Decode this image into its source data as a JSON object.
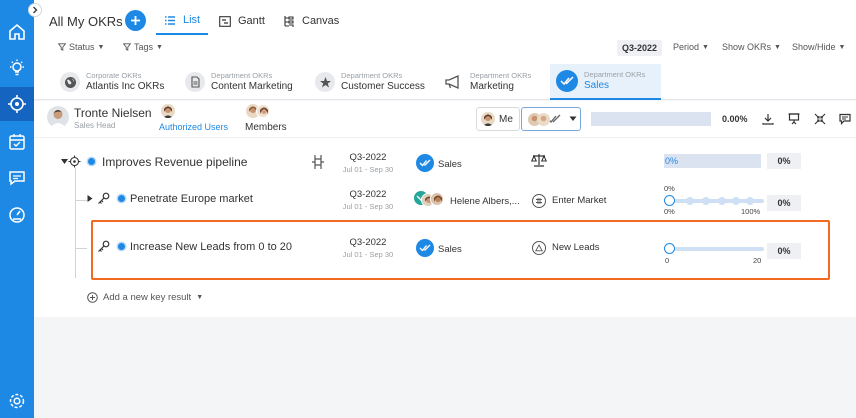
{
  "app": {
    "title": "All My OKRs"
  },
  "views": [
    {
      "label": "List",
      "icon": "list-icon",
      "active": true
    },
    {
      "label": "Gantt",
      "icon": "gantt-icon"
    },
    {
      "label": "Canvas",
      "icon": "canvas-icon"
    }
  ],
  "filters": {
    "status": "Status",
    "tags": "Tags",
    "quarter": "Q3-2022",
    "period": "Period",
    "show_okrs": "Show OKRs",
    "show_hide": "Show/Hide"
  },
  "okr_tabs": [
    {
      "sub": "Corporate OKRs",
      "name": "Atlantis Inc OKRs",
      "icon": "globe-icon"
    },
    {
      "sub": "Department OKRs",
      "name": "Content Marketing",
      "icon": "document-icon"
    },
    {
      "sub": "Department OKRs",
      "name": "Customer Success",
      "icon": "star-icon"
    },
    {
      "sub": "Department OKRs",
      "name": "Marketing",
      "icon": "megaphone-icon"
    },
    {
      "sub": "Department OKRs",
      "name": "Sales",
      "icon": "double-check-icon",
      "active": true
    }
  ],
  "user": {
    "name": "Tronte Nielsen",
    "role": "Sales Head",
    "authorized_users": "Authorized Users",
    "members": "Members",
    "me": "Me",
    "overall_progress": "0.00%"
  },
  "objectives": [
    {
      "title": "Improves Revenue pipeline",
      "quarter": "Q3-2022",
      "dates": "Jul 01 - Sep 30",
      "team": "Sales",
      "progress_label": "0%",
      "percent": "0%"
    },
    {
      "title": "Penetrate Europe market",
      "quarter": "Q3-2022",
      "dates": "Jul 01 - Sep 30",
      "team": "Helene Albers,...",
      "tag": "Enter Market",
      "progress_top": "0%",
      "progress_min": "0%",
      "progress_max": "100%",
      "percent": "0%"
    },
    {
      "title": "Increase New Leads from 0 to 20",
      "quarter": "Q3-2022",
      "dates": "Jul 01 - Sep 30",
      "team": "Sales",
      "tag": "New Leads",
      "range_min": "0",
      "range_max": "20",
      "percent": "0%"
    }
  ],
  "add_key_result": "Add a new key result",
  "colors": {
    "primary": "#1e88e5",
    "highlight": "#f26a21"
  }
}
